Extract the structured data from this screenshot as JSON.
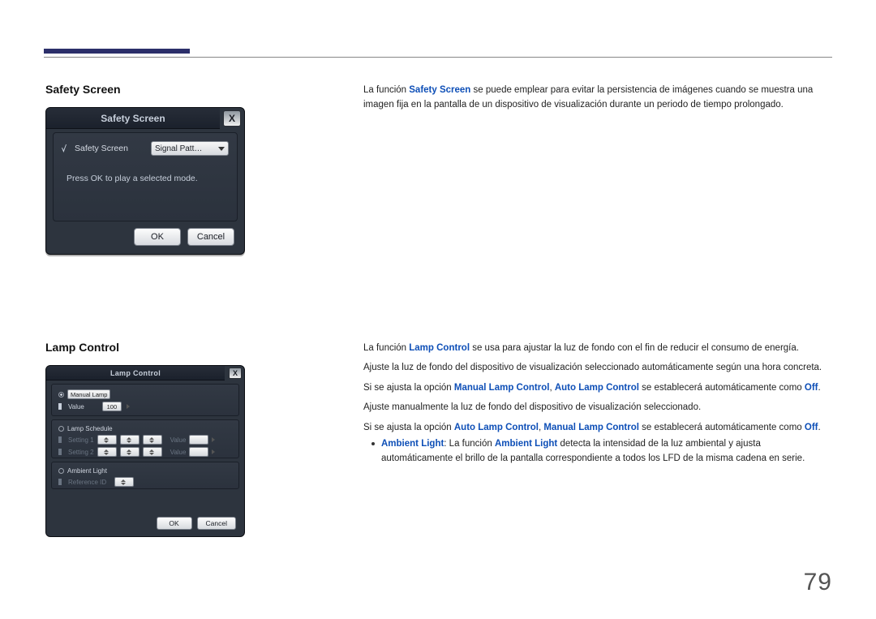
{
  "page_number": "79",
  "sections": {
    "safety_screen": {
      "heading": "Safety Screen",
      "desc_pre": "La función ",
      "desc_bold": "Safety Screen",
      "desc_post": " se puede emplear para evitar la persistencia de imágenes cuando se muestra una imagen fija en la pantalla de un dispositivo de visualización durante un periodo de tiempo prolongado."
    },
    "lamp_control": {
      "heading": "Lamp Control",
      "p1_pre": "La función ",
      "p1_bold": "Lamp Control",
      "p1_post": " se usa para ajustar la luz de fondo con el fin de reducir el consumo de energía.",
      "p2": "Ajuste la luz de fondo del dispositivo de visualización seleccionado automáticamente según una hora concreta.",
      "p3_a": "Si se ajusta la opción ",
      "p3_b": "Manual Lamp Control",
      "p3_c": ", ",
      "p3_d": "Auto Lamp Control",
      "p3_e": " se establecerá automáticamente como ",
      "p3_f": "Off",
      "p3_g": ".",
      "p4": "Ajuste manualmente la luz de fondo del dispositivo de visualización seleccionado.",
      "p5_a": "Si se ajusta la opción ",
      "p5_b": "Auto Lamp Control",
      "p5_c": ", ",
      "p5_d": "Manual Lamp Control",
      "p5_e": " se establecerá automáticamente como ",
      "p5_f": "Off",
      "p5_g": ".",
      "bullet_a": "Ambient Light",
      "bullet_b": ": La función ",
      "bullet_c": "Ambient Light",
      "bullet_d": " detecta la intensidad de la luz ambiental y ajusta automáticamente el brillo de la pantalla correspondiente a todos los LFD de la misma cadena en serie."
    }
  },
  "dialog_safety": {
    "title": "Safety Screen",
    "close": "X",
    "field_label": "Safety Screen",
    "dropdown_value": "Signal Patt…",
    "hint": "Press OK to play a selected mode.",
    "ok": "OK",
    "cancel": "Cancel"
  },
  "dialog_lamp": {
    "title": "Lamp Control",
    "close": "X",
    "manual_lamp": "Manual Lamp",
    "value_label": "Value",
    "value_num": "100",
    "lamp_schedule": "Lamp Schedule",
    "setting1": "Setting 1",
    "setting2": "Setting 2",
    "sched_value_label": "Value",
    "ambient_light": "Ambient Light",
    "reference": "Reference ID",
    "ok": "OK",
    "cancel": "Cancel"
  }
}
